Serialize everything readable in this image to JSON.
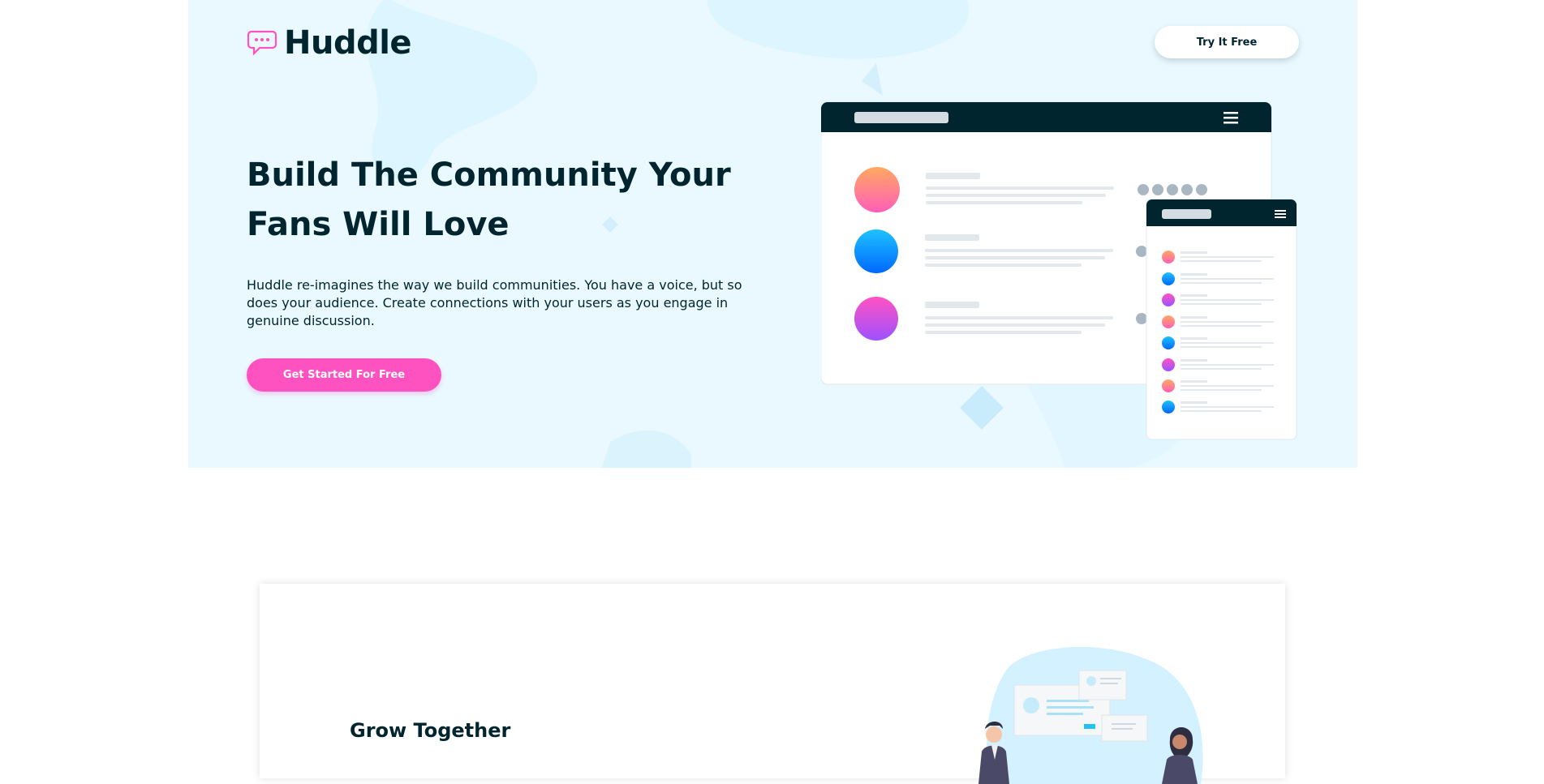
{
  "brand": {
    "name": "Huddle",
    "logo_icon": "chat-bubble-icon",
    "accent": "#ff52c1",
    "dark": "#00252e",
    "hero_bg": "#e9f9ff"
  },
  "header": {
    "cta_label": "Try It Free"
  },
  "hero": {
    "title": "Build The Community Your Fans Will Love",
    "description": "Huddle re-imagines the way we build communities. You have a voice, but so does your audience. Create connections with your users as you engage in genuine discussion.",
    "cta_label": "Get Started For Free"
  },
  "features": [
    {
      "title": "Grow Together"
    }
  ]
}
